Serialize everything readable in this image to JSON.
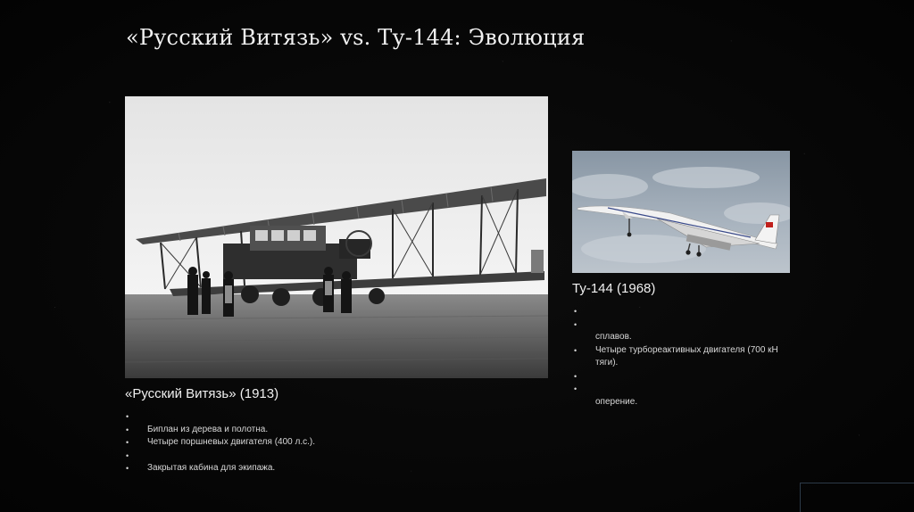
{
  "slide": {
    "title": "«Русский Витязь» vs. Ту-144: Эволюция"
  },
  "left": {
    "caption": "«Русский Витязь» (1913)",
    "image_subject": "biplane-photo",
    "bullets": [
      {
        "text": "",
        "marker": true
      },
      {
        "text": "Биплан из дерева и полотна.",
        "marker": true
      },
      {
        "text": "Четыре поршневых двигателя (400 л.с.).",
        "marker": true
      },
      {
        "text": "",
        "marker": true
      },
      {
        "text": "Закрытая кабина для экипажа.",
        "marker": true
      }
    ]
  },
  "right": {
    "caption": "Ту-144 (1968)",
    "image_subject": "supersonic-jet-photo",
    "bullets": [
      {
        "text": "",
        "marker": true
      },
      {
        "text": "",
        "marker": true
      },
      {
        "text": "сплавов.",
        "marker": false
      },
      {
        "text": "Четыре турбореактивных двигателя (700 кН тяги).",
        "marker": true
      },
      {
        "text": "",
        "marker": true
      },
      {
        "text": "",
        "marker": true
      },
      {
        "text": "оперение.",
        "marker": false
      }
    ]
  },
  "colors": {
    "background": "#050505",
    "text": "#f0f0f0",
    "accent_red": "#c0201c"
  }
}
